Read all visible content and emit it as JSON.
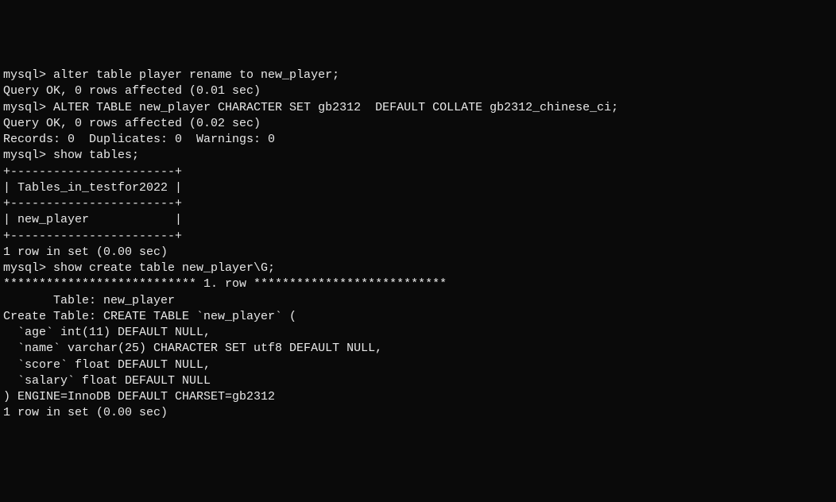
{
  "terminal": {
    "lines": [
      "mysql> alter table player rename to new_player;",
      "Query OK, 0 rows affected (0.01 sec)",
      "",
      "mysql> ALTER TABLE new_player CHARACTER SET gb2312  DEFAULT COLLATE gb2312_chinese_ci;",
      "Query OK, 0 rows affected (0.02 sec)",
      "Records: 0  Duplicates: 0  Warnings: 0",
      "",
      "mysql> show tables;",
      "+-----------------------+",
      "| Tables_in_testfor2022 |",
      "+-----------------------+",
      "| new_player            |",
      "+-----------------------+",
      "1 row in set (0.00 sec)",
      "",
      "mysql> show create table new_player\\G;",
      "*************************** 1. row ***************************",
      "       Table: new_player",
      "Create Table: CREATE TABLE `new_player` (",
      "  `age` int(11) DEFAULT NULL,",
      "  `name` varchar(25) CHARACTER SET utf8 DEFAULT NULL,",
      "  `score` float DEFAULT NULL,",
      "  `salary` float DEFAULT NULL",
      ") ENGINE=InnoDB DEFAULT CHARSET=gb2312",
      "1 row in set (0.00 sec)"
    ]
  }
}
